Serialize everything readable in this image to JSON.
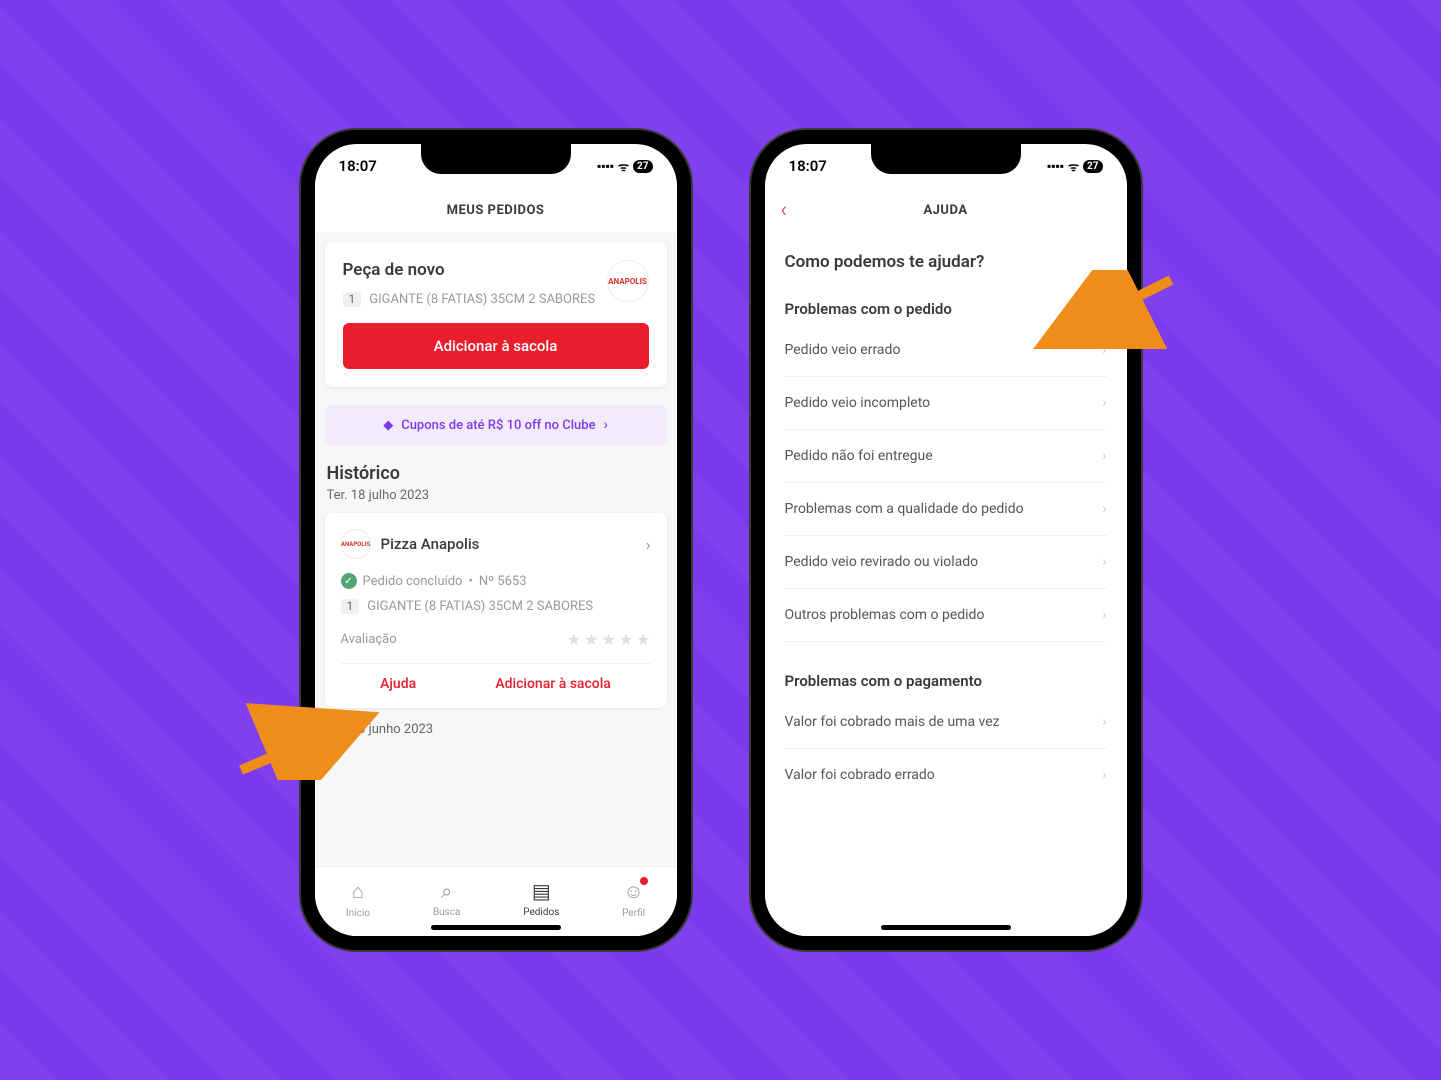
{
  "status_bar": {
    "time": "18:07",
    "battery": "27"
  },
  "phone1": {
    "nav_title": "MEUS PEDIDOS",
    "order_again": {
      "title": "Peça de novo",
      "merchant_logo_text": "ANAPOLIS",
      "qty": "1",
      "item_desc": "GIGANTE (8 FATIAS) 35CM 2 SABORES",
      "button": "Adicionar à sacola"
    },
    "promo": {
      "text": "Cupons de até R$ 10 off no Clube"
    },
    "history": {
      "title": "Histórico",
      "date": "Ter. 18 julho 2023",
      "merchant_name": "Pizza Anapolis",
      "status": "Pedido concluído",
      "order_no": "Nº 5653",
      "qty": "1",
      "item_desc": "GIGANTE (8 FATIAS) 35CM 2 SABORES",
      "rating_label": "Avaliação",
      "help_btn": "Ajuda",
      "add_btn": "Adicionar à sacola",
      "date2": "Ter. 20 junho 2023"
    },
    "tabs": {
      "inicio": "Início",
      "busca": "Busca",
      "pedidos": "Pedidos",
      "perfil": "Perfil"
    }
  },
  "phone2": {
    "nav_title": "AJUDA",
    "heading": "Como podemos te ajudar?",
    "section_order": "Problemas com o pedido",
    "items_order": [
      "Pedido veio errado",
      "Pedido veio incompleto",
      "Pedido não foi entregue",
      "Problemas com a qualidade do pedido",
      "Pedido veio revirado ou violado",
      "Outros problemas com o pedido"
    ],
    "section_payment": "Problemas com o pagamento",
    "items_payment": [
      "Valor foi cobrado mais de uma vez",
      "Valor foi cobrado errado"
    ]
  }
}
